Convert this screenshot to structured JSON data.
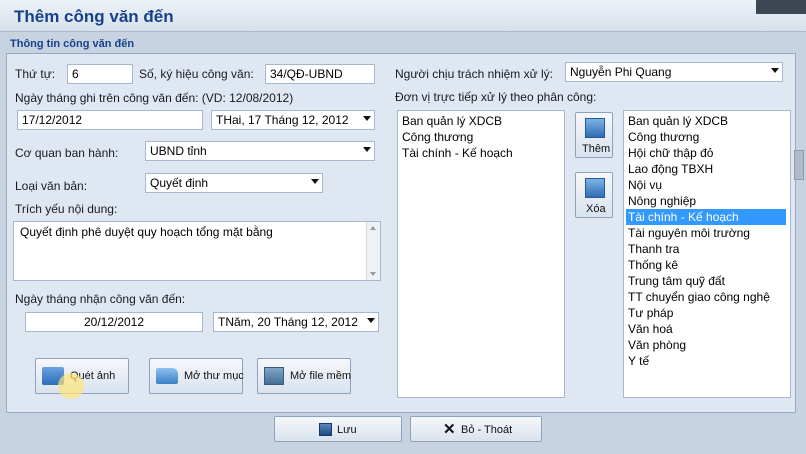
{
  "window": {
    "title": "Thêm công văn đến"
  },
  "group": {
    "label": "Thông tin công văn đến"
  },
  "form": {
    "so_thu_tu_label": "Thứ tự:",
    "so_thu_tu_value": "6",
    "so_ky_hieu_label": "Số, ký hiệu công văn:",
    "so_ky_hieu_value": "34/QĐ-UBND",
    "ngay_ghi_label": "Ngày tháng ghi trên công văn đến: (VD: 12/08/2012)",
    "ngay_ghi_value": "17/12/2012",
    "ngay_ghi_picker": "THai, 17  Tháng 12, 2012",
    "co_quan_label": "Cơ quan ban hành:",
    "co_quan_value": "UBND tỉnh",
    "loai_vb_label": "Loại văn bản:",
    "loai_vb_value": "Quyết định",
    "trich_yeu_label": "Trích yếu nội dung:",
    "trich_yeu_value": "Quyết định phê duyệt quy hoạch tổng mặt bằng",
    "ngay_nhan_label": "Ngày tháng nhận công văn đến:",
    "ngay_nhan_value": "20/12/2012",
    "ngay_nhan_picker": "TNăm, 20  Tháng 12, 2012"
  },
  "responsible": {
    "label": "Người chịu trách nhiệm xử lý:",
    "value": "Nguyễn Phi Quang"
  },
  "assign": {
    "label": "Đơn vị trực tiếp xử lý theo phân công:",
    "selected_units": [
      "Ban quản lý XDCB",
      "Công thương",
      "Tài chính - Kế hoạch"
    ],
    "all_units": [
      "Ban quản lý XDCB",
      "Công thương",
      "Hội chữ thập đỏ",
      "Lao động TBXH",
      "Nội vụ",
      "Nông nghiệp",
      "Tài chính - Kế hoạch",
      "Tài nguyên môi trường",
      "Thanh tra",
      "Thống kê",
      "Trung tâm quỹ đất",
      "TT chuyển giao công nghệ",
      "Tư pháp",
      "Văn hoá",
      "Văn phòng",
      "Y tế"
    ],
    "highlighted_index": 6,
    "add_label": "Thêm",
    "remove_label": "Xóa"
  },
  "buttons": {
    "scan": "Quét ảnh",
    "open_folder": "Mở thư mục",
    "open_file": "Mở file mềm",
    "save": "Lưu",
    "exit": "Bỏ - Thoát"
  },
  "colors": {
    "title": "#15428b",
    "selection": "#3399ff",
    "panel": "#dfe7f3"
  }
}
